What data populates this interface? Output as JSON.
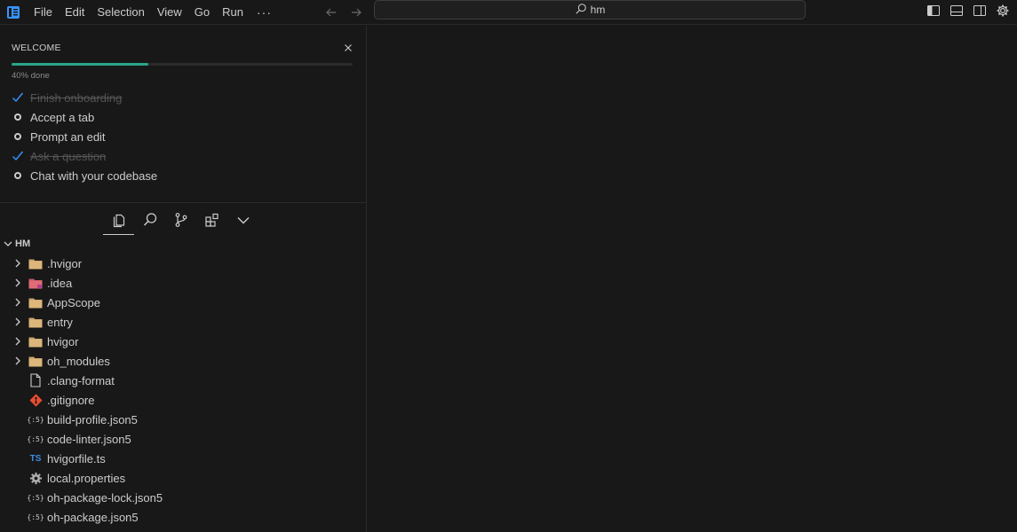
{
  "menu": [
    "File",
    "Edit",
    "Selection",
    "View",
    "Go",
    "Run"
  ],
  "menu_more": "···",
  "search": {
    "text": "hm"
  },
  "welcome": {
    "title": "WELCOME",
    "progress_text": "40% done",
    "progress_fraction": 0.4,
    "items": [
      {
        "label": "Finish onboarding",
        "done": true
      },
      {
        "label": "Accept a tab",
        "done": false
      },
      {
        "label": "Prompt an edit",
        "done": false
      },
      {
        "label": "Ask a question",
        "done": true
      },
      {
        "label": "Chat with your codebase",
        "done": false
      }
    ]
  },
  "explorer": {
    "root": "HM",
    "items": [
      {
        "name": ".hvigor",
        "type": "folder",
        "icon": "folder-icon"
      },
      {
        "name": ".idea",
        "type": "folder",
        "icon": "idea-folder-icon"
      },
      {
        "name": "AppScope",
        "type": "folder",
        "icon": "folder-icon"
      },
      {
        "name": "entry",
        "type": "folder",
        "icon": "folder-icon"
      },
      {
        "name": "hvigor",
        "type": "folder",
        "icon": "folder-icon"
      },
      {
        "name": "oh_modules",
        "type": "folder",
        "icon": "folder-icon"
      },
      {
        "name": ".clang-format",
        "type": "file",
        "icon": "file-icon"
      },
      {
        "name": ".gitignore",
        "type": "file",
        "icon": "git-icon"
      },
      {
        "name": "build-profile.json5",
        "type": "file",
        "icon": "json5-icon"
      },
      {
        "name": "code-linter.json5",
        "type": "file",
        "icon": "json5-icon"
      },
      {
        "name": "hvigorfile.ts",
        "type": "file",
        "icon": "ts-icon"
      },
      {
        "name": "local.properties",
        "type": "file",
        "icon": "gear-icon"
      },
      {
        "name": "oh-package-lock.json5",
        "type": "file",
        "icon": "json5-icon"
      },
      {
        "name": "oh-package.json5",
        "type": "file",
        "icon": "json5-icon"
      }
    ]
  },
  "icon_labels": {
    "ts": "TS",
    "json5": "{:5}"
  },
  "colors": {
    "accent": "#2aa58c",
    "check": "#3794ff",
    "background": "#181818"
  }
}
